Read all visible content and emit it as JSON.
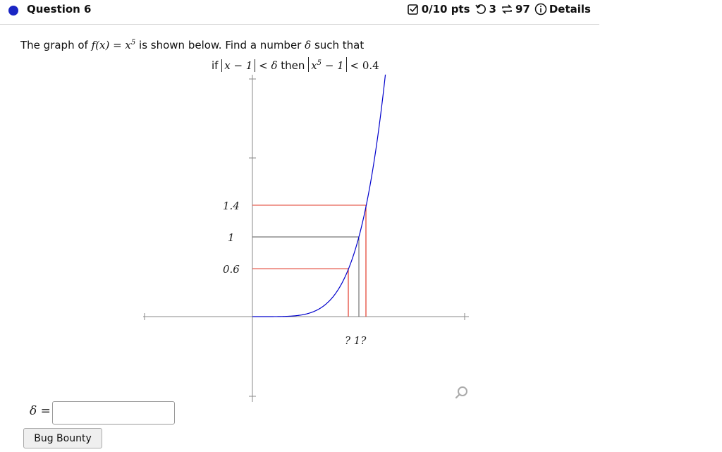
{
  "header": {
    "question_title": "Question 6",
    "points": "0/10 pts",
    "retries": "3",
    "attempts": "97",
    "details_label": "Details",
    "icons": {
      "points": "checkbox-edit-icon",
      "retries": "undo-icon",
      "attempts": "repeat-icon",
      "details": "info-icon"
    },
    "accent_color": "#1a26c4"
  },
  "problem": {
    "intro": "The graph of",
    "func": "f(x) = x",
    "exp": "5",
    "middle": "is shown below. Find a number",
    "delta": "δ",
    "tail": "such that",
    "if_word": "if",
    "cond1": "x − 1",
    "lt1": "< δ",
    "then_word": "then",
    "cond2_base": "x",
    "cond2_exp": "5",
    "cond2_rest": "− 1",
    "lt2": "< 0.4"
  },
  "graph": {
    "y_labels": [
      "1.4",
      "1",
      "0.6"
    ],
    "x_label": "? 1?",
    "curve_color": "#0000cc",
    "guide_red": "#e23a2a",
    "guide_gray": "#555555"
  },
  "answer": {
    "delta_label": "δ =",
    "input_value": "",
    "input_placeholder": ""
  },
  "buttons": {
    "bug_bounty": "Bug Bounty"
  },
  "zoom": {
    "icon": "zoom-icon"
  }
}
